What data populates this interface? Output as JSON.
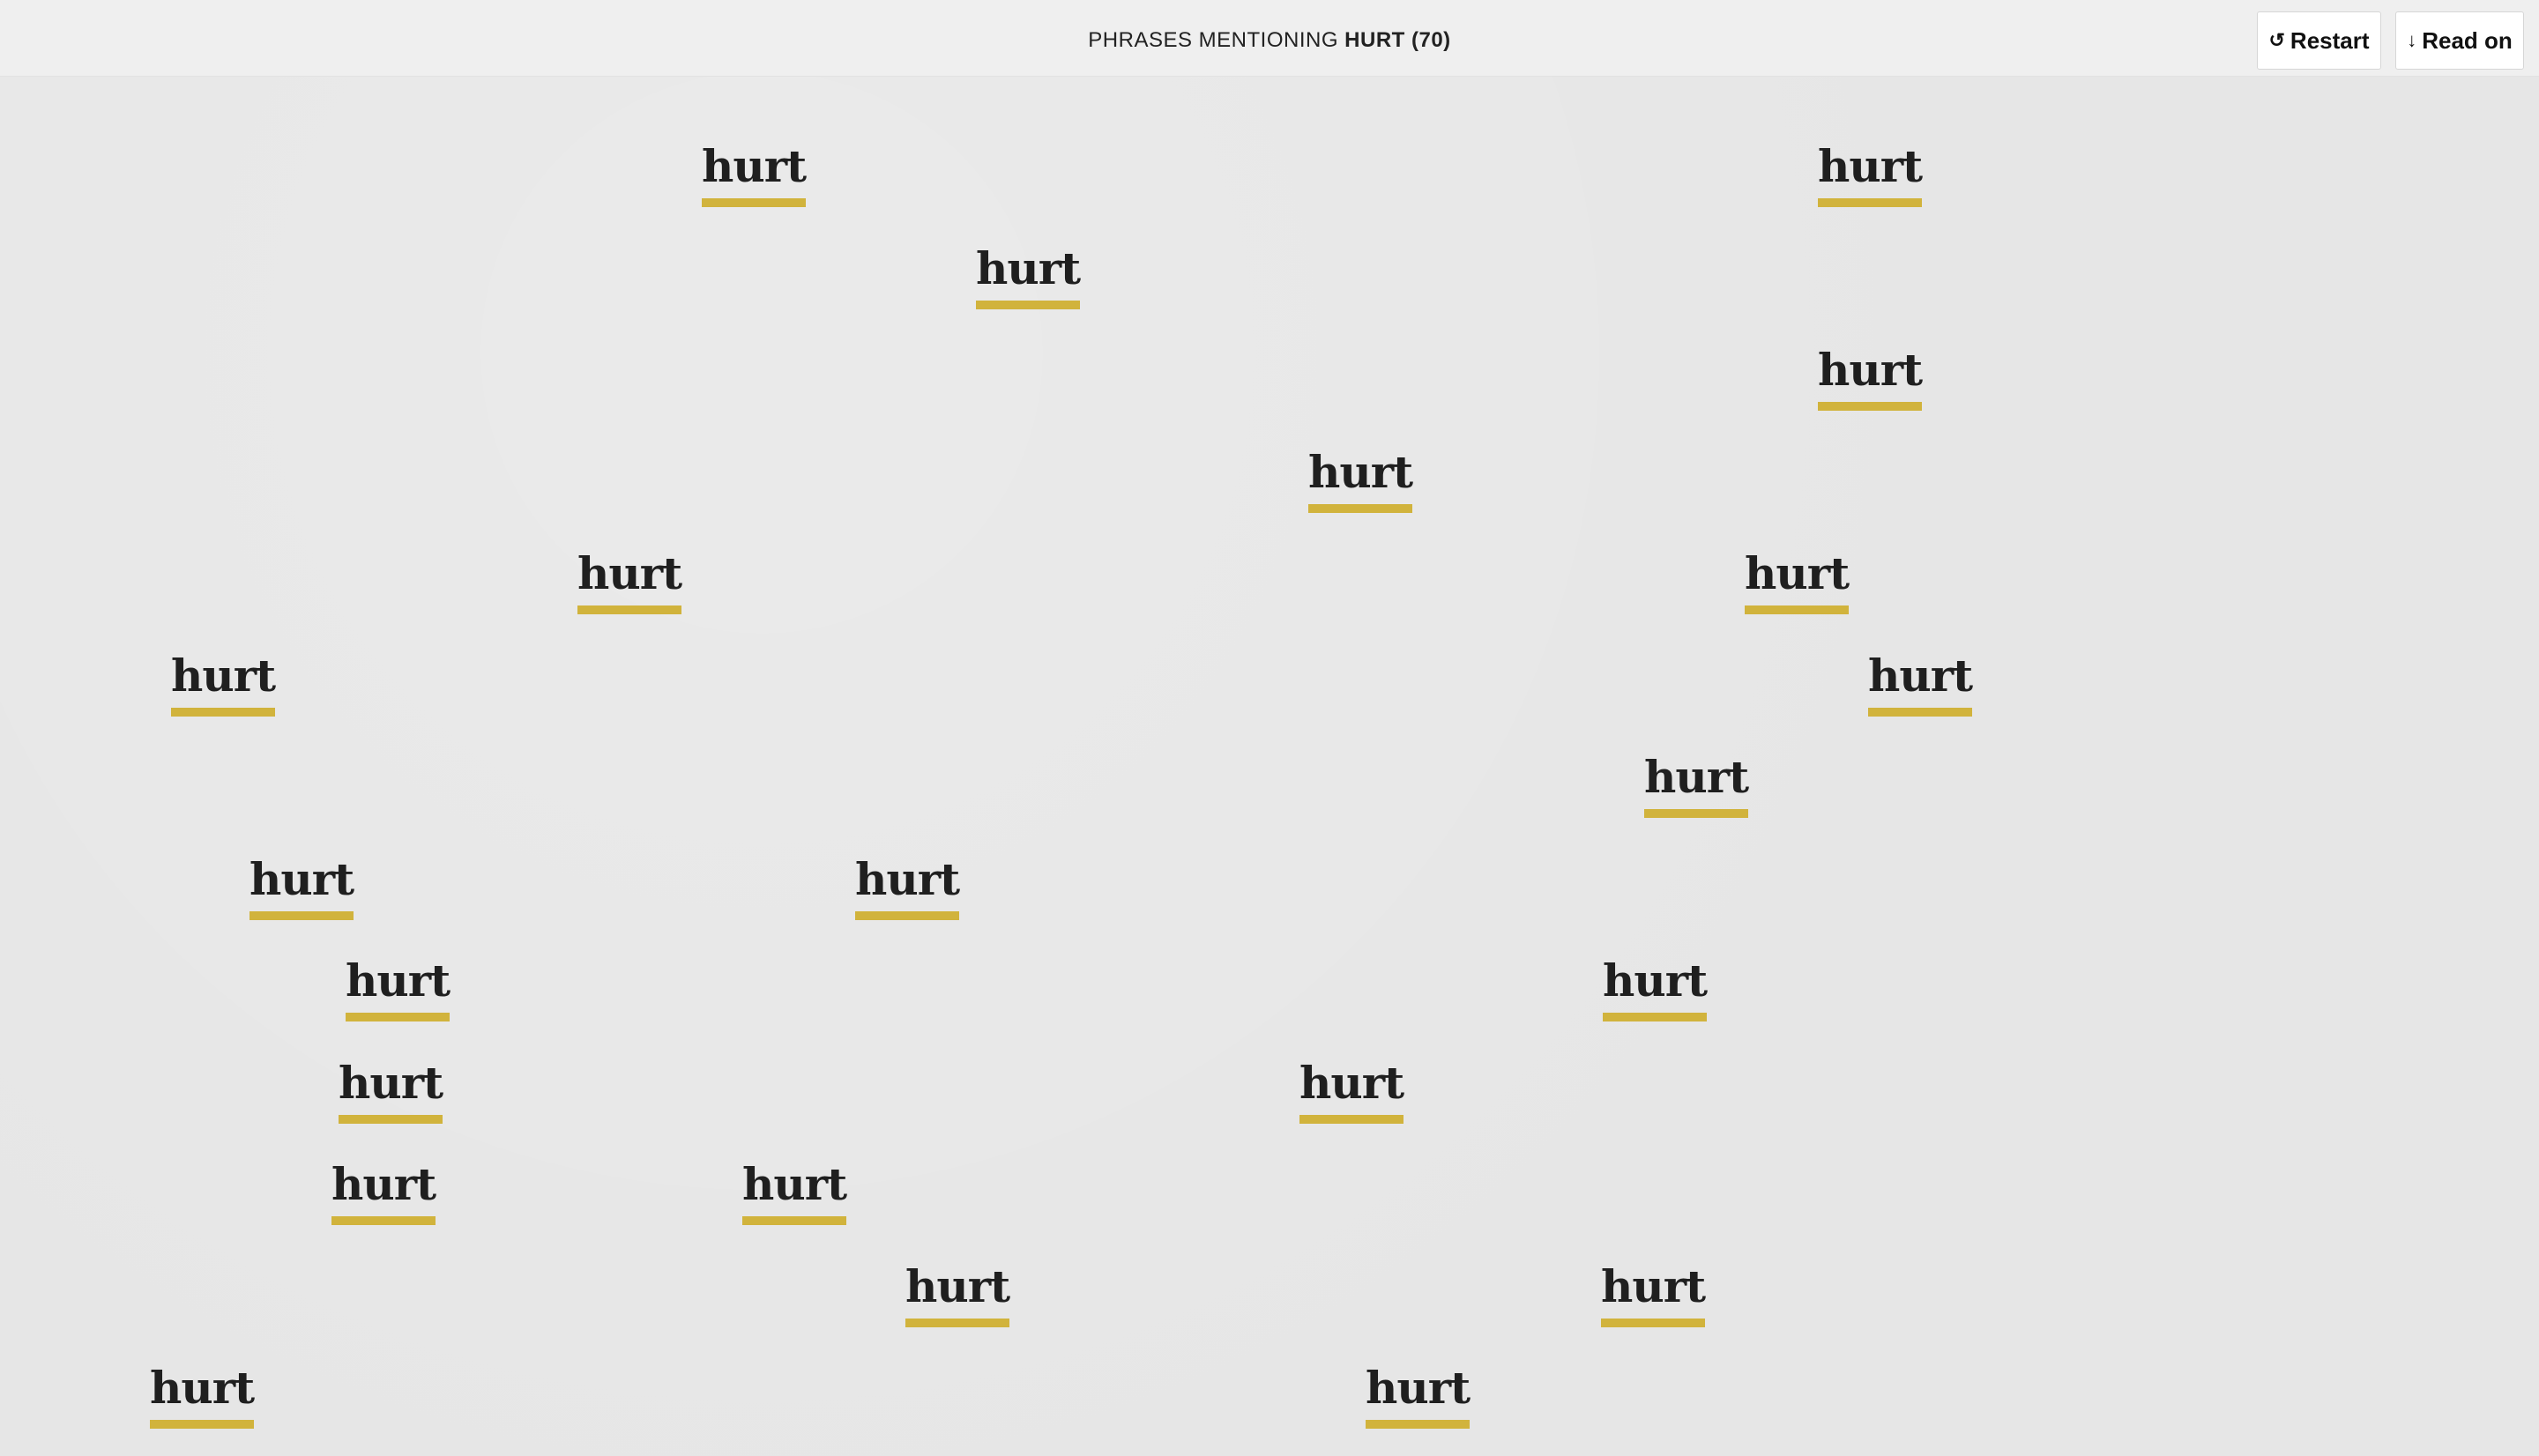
{
  "header": {
    "title_prefix": "PHRASES MENTIONING",
    "title_word": "HURT (70)",
    "restart_icon": "restart-icon",
    "restart_glyph": "↺",
    "restart_label": "Restart",
    "readon_icon": "arrow-down-icon",
    "readon_glyph": "↓",
    "readon_label": "Read on"
  },
  "colors": {
    "underline": "#d1b33c",
    "text": "#1f1f1f",
    "background": "#e6e6e6"
  },
  "words": [
    "hurt",
    "hurt",
    "hurt",
    "hurt",
    "hurt",
    "hurt",
    "hurt",
    "hurt",
    "hurt",
    "hurt",
    "hurt",
    "hurt",
    "hurt",
    "hurt",
    "hurt",
    "hurt",
    "hurt",
    "hurt",
    "hurt",
    "hurt",
    "hurt",
    "hurt"
  ]
}
